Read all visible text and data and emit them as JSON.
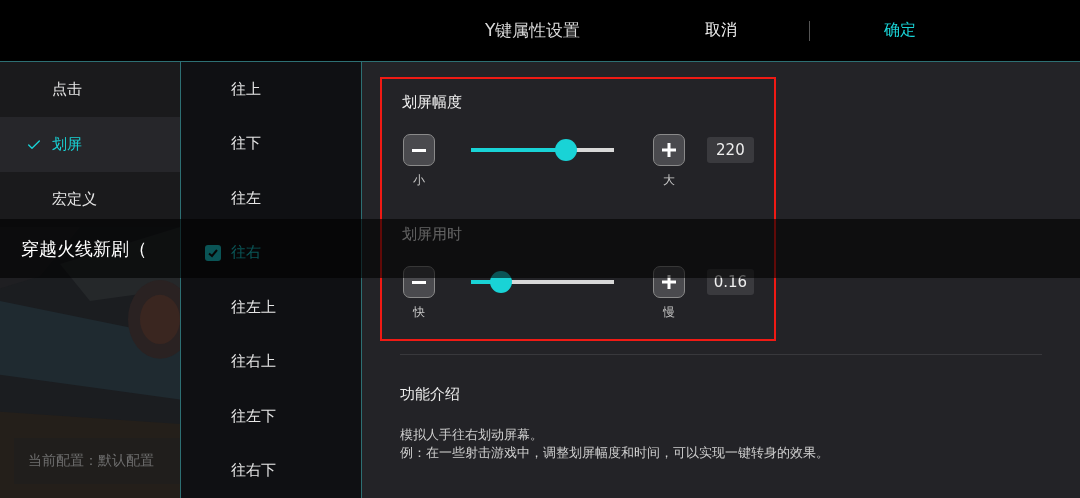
{
  "header": {
    "title": "Y键属性设置",
    "cancel": "取消",
    "confirm": "确定"
  },
  "modes": [
    {
      "label": "点击",
      "selected": false
    },
    {
      "label": "划屏",
      "selected": true
    },
    {
      "label": "宏定义",
      "selected": false
    }
  ],
  "current_config": "当前配置：默认配置",
  "directions": [
    {
      "label": "往上",
      "checked": false
    },
    {
      "label": "往下",
      "checked": false
    },
    {
      "label": "往左",
      "checked": false
    },
    {
      "label": "往右",
      "checked": true
    },
    {
      "label": "往左上",
      "checked": false
    },
    {
      "label": "往右上",
      "checked": false
    },
    {
      "label": "往左下",
      "checked": false
    },
    {
      "label": "往右下",
      "checked": false
    }
  ],
  "settings": [
    {
      "title": "划屏幅度",
      "level": 0.66,
      "value": "220",
      "min_label": "小",
      "max_label": "大"
    },
    {
      "title": "划屏用时",
      "level": 0.21,
      "value": "0.16",
      "min_label": "快",
      "max_label": "慢"
    }
  ],
  "intro": {
    "title": "功能介绍",
    "lines": [
      "模拟人手往右划动屏幕。",
      "例：在一些射击游戏中，调整划屏幅度和时间，可以实现一键转身的效果。"
    ]
  },
  "subtitle": "穿越火线新剧（"
}
